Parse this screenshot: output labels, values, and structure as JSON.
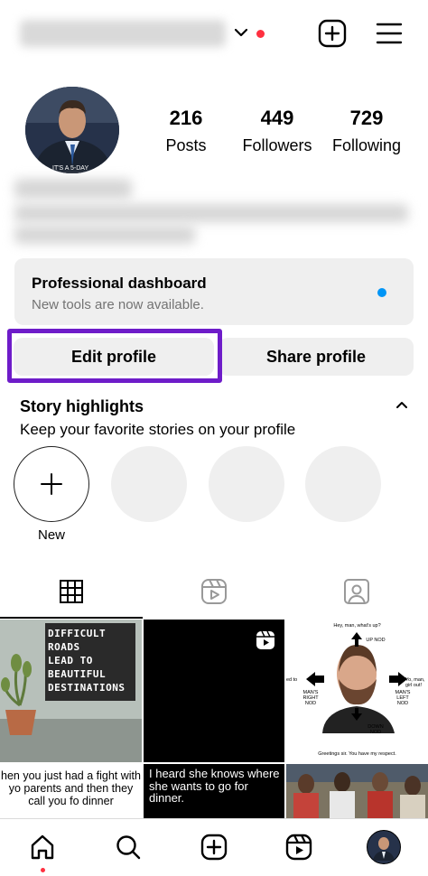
{
  "header": {
    "username_icon": "chevron-down-icon",
    "notification_color": "#ff3040",
    "create_icon": "plus-square-icon",
    "menu_icon": "hamburger-icon"
  },
  "profile": {
    "stats": [
      {
        "value": "216",
        "label": "Posts"
      },
      {
        "value": "449",
        "label": "Followers"
      },
      {
        "value": "729",
        "label": "Following"
      }
    ]
  },
  "dashboard": {
    "title": "Professional dashboard",
    "subtitle": "New tools are now available.",
    "dot_color": "#0095f6"
  },
  "actions": {
    "edit_label": "Edit profile",
    "share_label": "Share profile",
    "highlight_color": "#6e1cc9"
  },
  "highlights": {
    "title": "Story highlights",
    "subtitle": "Keep your favorite stories on your profile",
    "new_label": "New"
  },
  "tabs": [
    {
      "icon": "grid-icon",
      "active": true
    },
    {
      "icon": "reels-icon",
      "active": false
    },
    {
      "icon": "tagged-icon",
      "active": false
    }
  ],
  "posts": {
    "post1_board": [
      "DIFFICULT",
      "ROADS",
      "LEAD TO",
      "BEAUTIFUL",
      "DESTINATIONS"
    ],
    "post3_lines": {
      "top": "Hey, man, what's up?",
      "up": "UP NOD",
      "left": "MAN'S RIGHT NOD",
      "right": "MAN'S LEFT NOD",
      "down": "DOWN NOD",
      "bottom": "Greetings sir. You have my respect.",
      "left_edge": "ed to",
      "right_edge": "Yo, man, girl out!"
    },
    "post4_caption": "hen you just had a fight with yo parents and then they call you fo dinner",
    "post5_caption": "I heard she knows where she wants to go for dinner."
  },
  "nav": [
    {
      "icon": "home-icon"
    },
    {
      "icon": "search-icon"
    },
    {
      "icon": "create-icon"
    },
    {
      "icon": "reels-icon"
    },
    {
      "icon": "profile-avatar"
    }
  ]
}
